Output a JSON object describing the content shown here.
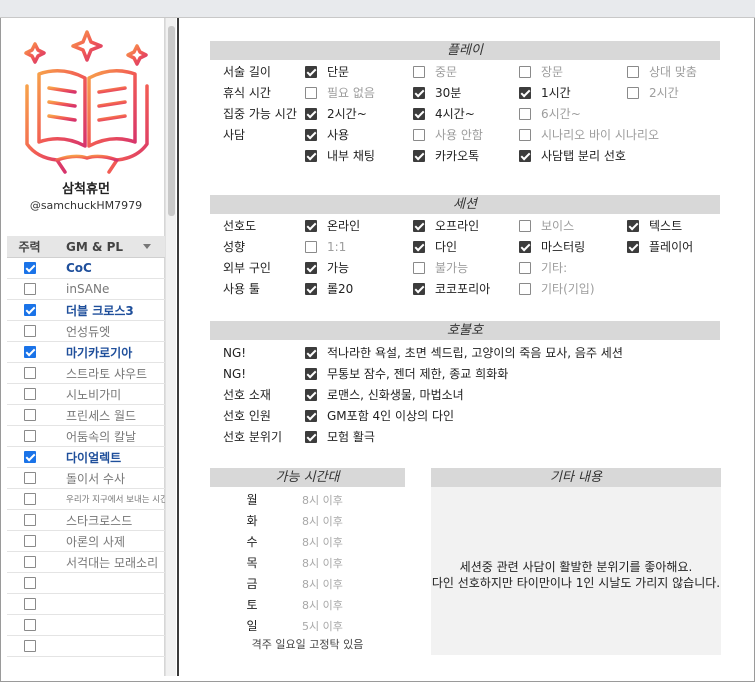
{
  "profile": {
    "name": "삼척휴먼",
    "handle": "@samchuckHM7979"
  },
  "systems": {
    "header_main": "주력",
    "header_name": "GM & PL",
    "items": [
      {
        "label": "CoC",
        "checked": true
      },
      {
        "label": "inSANe",
        "checked": false
      },
      {
        "label": "더블 크로스3",
        "checked": true
      },
      {
        "label": "언성듀엣",
        "checked": false
      },
      {
        "label": "마기카로기아",
        "checked": true
      },
      {
        "label": "스트라토 샤우트",
        "checked": false
      },
      {
        "label": "시노비가미",
        "checked": false
      },
      {
        "label": "프린세스 월드",
        "checked": false
      },
      {
        "label": "어둠속의 칼날",
        "checked": false
      },
      {
        "label": "다이얼렉트",
        "checked": true
      },
      {
        "label": "돌이서 수사",
        "checked": false
      },
      {
        "label": "우리가 지구에서 보내는 시간",
        "checked": false
      },
      {
        "label": "스타크로스드",
        "checked": false
      },
      {
        "label": "아론의 사제",
        "checked": false
      },
      {
        "label": "서걱대는 모래소리",
        "checked": false
      },
      {
        "label": "",
        "checked": false
      },
      {
        "label": "",
        "checked": false
      },
      {
        "label": "",
        "checked": false
      },
      {
        "label": "",
        "checked": false
      }
    ]
  },
  "play": {
    "title": "플레이",
    "rows": [
      {
        "label": "서술 길이",
        "options": [
          {
            "text": "단문",
            "checked": true
          },
          {
            "text": "중문",
            "checked": false
          },
          {
            "text": "장문",
            "checked": false
          },
          {
            "text": "상대 맞춤",
            "checked": false
          }
        ]
      },
      {
        "label": "휴식 시간",
        "options": [
          {
            "text": "필요 없음",
            "checked": false
          },
          {
            "text": "30분",
            "checked": true
          },
          {
            "text": "1시간",
            "checked": true
          },
          {
            "text": "2시간",
            "checked": false
          }
        ]
      },
      {
        "label": "집중 가능 시간",
        "options": [
          {
            "text": "2시간~",
            "checked": true
          },
          {
            "text": "4시간~",
            "checked": true
          },
          {
            "text": "6시간~",
            "checked": false
          }
        ]
      },
      {
        "label": "사담",
        "options": [
          {
            "text": "사용",
            "checked": true
          },
          {
            "text": "사용 안함",
            "checked": false
          },
          {
            "text": "시나리오 바이 시나리오",
            "checked": false
          }
        ]
      },
      {
        "label": "",
        "options": [
          {
            "text": "내부 채팅",
            "checked": true
          },
          {
            "text": "카카오톡",
            "checked": true
          },
          {
            "text": "사담탭 분리 선호",
            "checked": true
          }
        ]
      }
    ]
  },
  "session": {
    "title": "세션",
    "rows": [
      {
        "label": "선호도",
        "options": [
          {
            "text": "온라인",
            "checked": true
          },
          {
            "text": "오프라인",
            "checked": true
          },
          {
            "text": "보이스",
            "checked": false
          },
          {
            "text": "텍스트",
            "checked": true
          }
        ]
      },
      {
        "label": "성향",
        "options": [
          {
            "text": "1:1",
            "checked": false
          },
          {
            "text": "다인",
            "checked": true
          },
          {
            "text": "마스터링",
            "checked": true
          },
          {
            "text": "플레이어",
            "checked": true
          }
        ]
      },
      {
        "label": "외부 구인",
        "options": [
          {
            "text": "가능",
            "checked": true
          },
          {
            "text": "불가능",
            "checked": false
          },
          {
            "text": "기타:",
            "checked": false
          }
        ]
      },
      {
        "label": "사용 툴",
        "options": [
          {
            "text": "롤20",
            "checked": true
          },
          {
            "text": "코코포리아",
            "checked": true
          },
          {
            "text": "기타(기입)",
            "checked": false
          }
        ]
      }
    ]
  },
  "likes": {
    "title": "호불호",
    "rows": [
      {
        "label": "NG!",
        "text": "적나라한 욕설, 초면 섹드립, 고양이의 죽음 묘사, 음주 세션",
        "checked": true
      },
      {
        "label": "NG!",
        "text": "무통보 잠수, 젠더 제한, 종교 희화화",
        "checked": true
      },
      {
        "label": "선호 소재",
        "text": "로맨스, 신화생물, 마법소녀",
        "checked": true
      },
      {
        "label": "선호 인원",
        "text": "GM포함 4인 이상의 다인",
        "checked": true
      },
      {
        "label": "선호 분위기",
        "text": "모험 활극",
        "checked": true
      }
    ]
  },
  "availability": {
    "title": "가능 시간대",
    "days": [
      {
        "day": "월",
        "time": "8시 이후"
      },
      {
        "day": "화",
        "time": "8시 이후"
      },
      {
        "day": "수",
        "time": "8시 이후"
      },
      {
        "day": "목",
        "time": "8시 이후"
      },
      {
        "day": "금",
        "time": "8시 이후"
      },
      {
        "day": "토",
        "time": "8시 이후"
      },
      {
        "day": "일",
        "time": "5시 이후"
      }
    ],
    "note": "격주 일요일 고정탁 있음"
  },
  "etc": {
    "title": "기타 내용",
    "line1": "세션중 관련 사담이 활발한 분위기를 좋아해요.",
    "line2": "다인 선호하지만 타이만이나 1인 시날도 가리지 않습니다."
  },
  "colors": {
    "accent_blue": "#1a73e8",
    "system_blue": "#1f4f9b",
    "check_dark": "#3c3c3c",
    "header_gray": "#d8d8d8"
  }
}
